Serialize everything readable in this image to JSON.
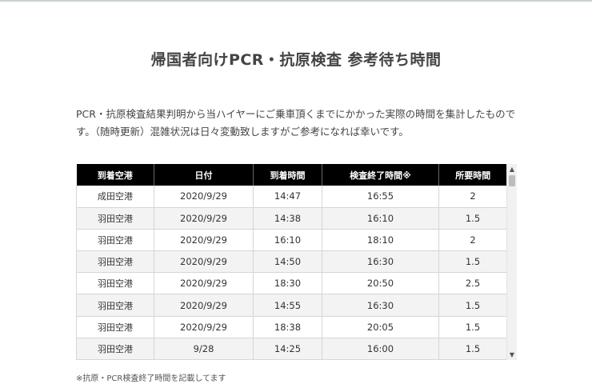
{
  "page": {
    "title": "帰国者向けPCR・抗原検査 参考待ち時間",
    "intro_line1": "PCR・抗原検査結果判明から当ハイヤーにご乗車頂くまでにかかった実際の時間を集計したものです。（随時更新）混雑状況は日々変動致しますがご参考になれば幸いです。",
    "footnote": "※抗原・PCR検査終了時間を記載してます"
  },
  "table": {
    "headers": [
      "到着空港",
      "日付",
      "到着時間",
      "検査終了時間※",
      "所要時間"
    ],
    "rows": [
      [
        "成田空港",
        "2020/9/29",
        "14:47",
        "16:55",
        "2"
      ],
      [
        "羽田空港",
        "2020/9/29",
        "14:38",
        "16:10",
        "1.5"
      ],
      [
        "羽田空港",
        "2020/9/29",
        "16:10",
        "18:10",
        "2"
      ],
      [
        "羽田空港",
        "2020/9/29",
        "14:50",
        "16:30",
        "1.5"
      ],
      [
        "羽田空港",
        "2020/9/29",
        "18:30",
        "20:50",
        "2.5"
      ],
      [
        "羽田空港",
        "2020/9/29",
        "14:55",
        "16:30",
        "1.5"
      ],
      [
        "羽田空港",
        "2020/9/29",
        "18:38",
        "20:05",
        "1.5"
      ],
      [
        "羽田空港",
        "9/28",
        "14:25",
        "16:00",
        "1.5"
      ]
    ]
  },
  "scrollbar": {
    "up_icon": "▲",
    "down_icon": "▼"
  }
}
